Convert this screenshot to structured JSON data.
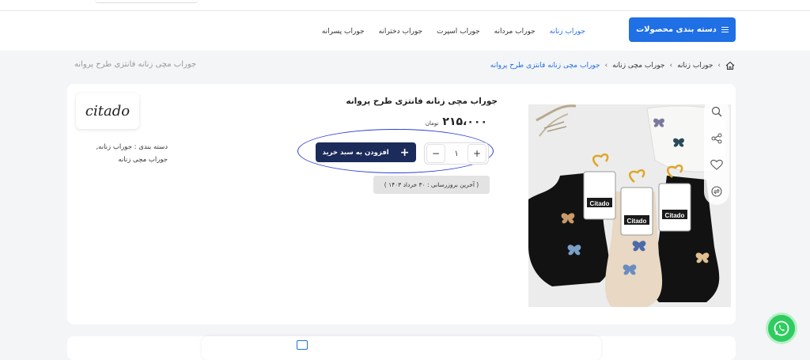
{
  "header": {
    "category_button": "دسته بندی محصولات",
    "menu": [
      "جوراب زنانه",
      "جوراب مردانه",
      "جوراب اسپرت",
      "جوراب دخترانه",
      "جوراب پسرانه"
    ]
  },
  "breadcrumb": {
    "items": [
      "جوراب زنانه",
      "جوراب مچی زنانه",
      "جوراب مچی زنانه فانتزی طرح پروانه"
    ],
    "page_heading": "جوراب مچی زنانه فانتزی طرح پروانه"
  },
  "product": {
    "title": "جوراب مچی زنانه فانتزی طرح پروانه",
    "price": "۲۱۵،۰۰۰",
    "currency": "تومان",
    "quantity": "۱",
    "plus": "+",
    "minus": "−",
    "add_to_cart": "افزودن به سبد خرید",
    "last_update": "( آخرین بروزرسانی : ۳۰ خرداد ۱۴۰۳ )",
    "brand_logo": "citado",
    "category_label": "دسته بندی : جوراب زنانه,",
    "category_sub": "جوراب مچی زنانه",
    "image_labels": "Citado"
  },
  "colors": {
    "primary": "#1f6fe5",
    "cart_button": "#1b2b5a",
    "whatsapp": "#2fcc5f",
    "annotation": "#2b3fd8"
  },
  "icons": [
    "home-icon",
    "zoom-icon",
    "share-icon",
    "heart-icon",
    "compare-icon",
    "whatsapp-icon",
    "book-icon"
  ]
}
